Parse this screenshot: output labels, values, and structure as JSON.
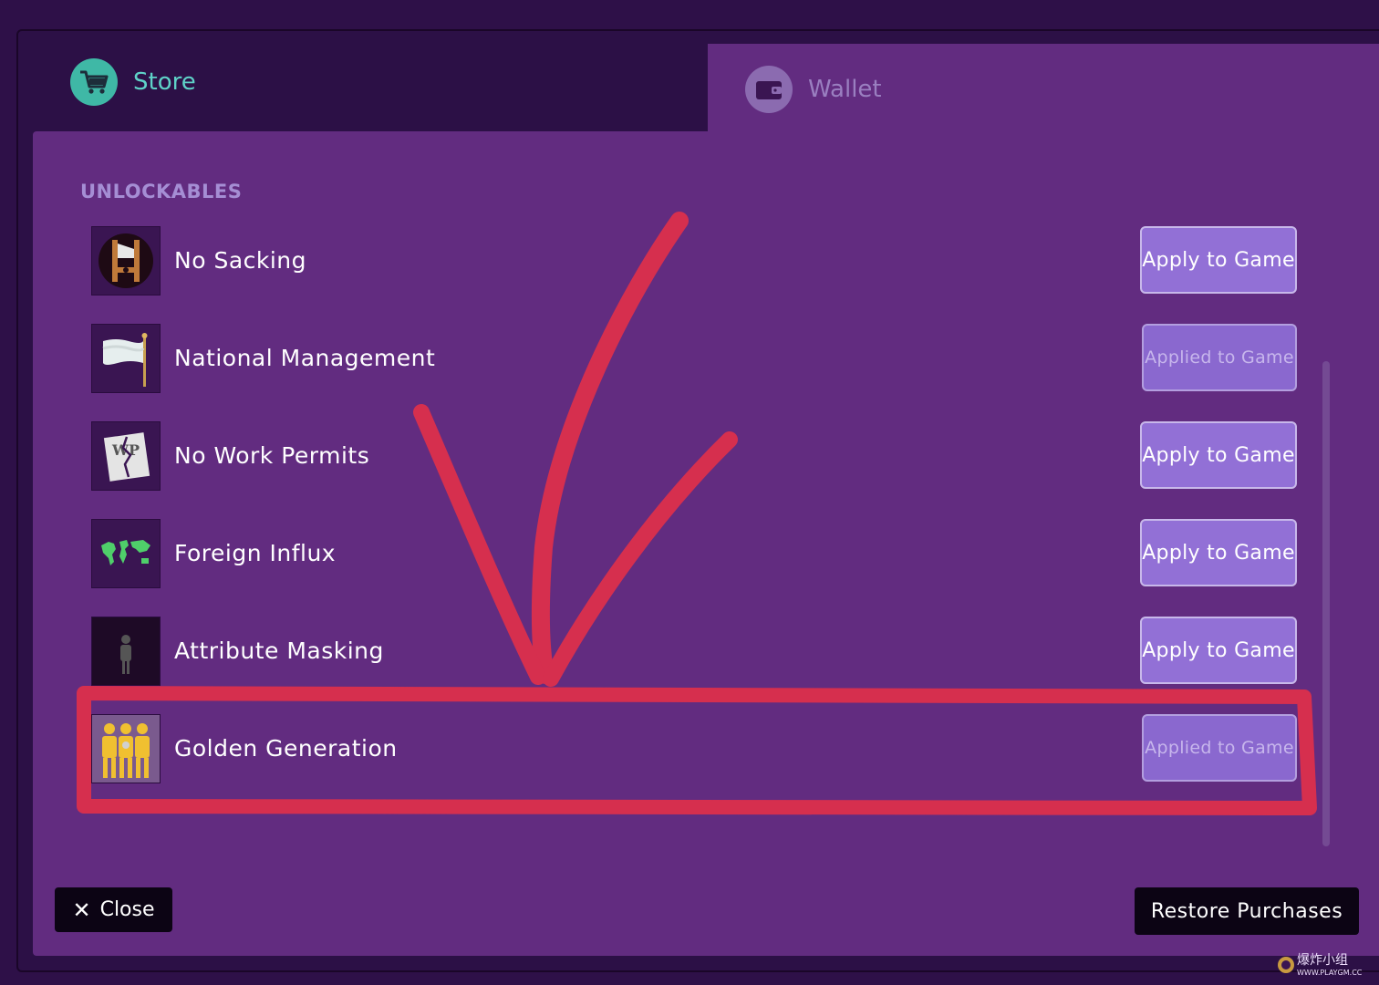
{
  "tabs": {
    "store": {
      "label": "Store",
      "icon": "shopping-cart-icon"
    },
    "wallet": {
      "label": "Wallet",
      "icon": "wallet-icon"
    }
  },
  "section_title": "UNLOCKABLES",
  "items": [
    {
      "label": "No Sacking",
      "icon": "guillotine-icon",
      "button": "Apply to Game",
      "applied": false
    },
    {
      "label": "National Management",
      "icon": "white-flag-icon",
      "button": "Applied to Game",
      "applied": true
    },
    {
      "label": "No Work Permits",
      "icon": "torn-work-permit-icon",
      "button": "Apply to Game",
      "applied": false
    },
    {
      "label": "Foreign Influx",
      "icon": "world-map-icon",
      "button": "Apply to Game",
      "applied": false
    },
    {
      "label": "Attribute Masking",
      "icon": "silhouette-person-icon",
      "button": "Apply to Game",
      "applied": false
    },
    {
      "label": "Golden Generation",
      "icon": "golden-players-icon",
      "button": "Applied to Game",
      "applied": true
    }
  ],
  "footer": {
    "close_label": "Close",
    "restore_label": "Restore Purchases"
  },
  "watermark": {
    "text": "爆炸小组",
    "url": "WWW.PLAYGM.CC"
  },
  "colors": {
    "panel": "#622c80",
    "frame": "#2c1046",
    "accent_teal": "#3fb8a6",
    "button": "#9270d6",
    "annotation_red": "#e0304a"
  }
}
